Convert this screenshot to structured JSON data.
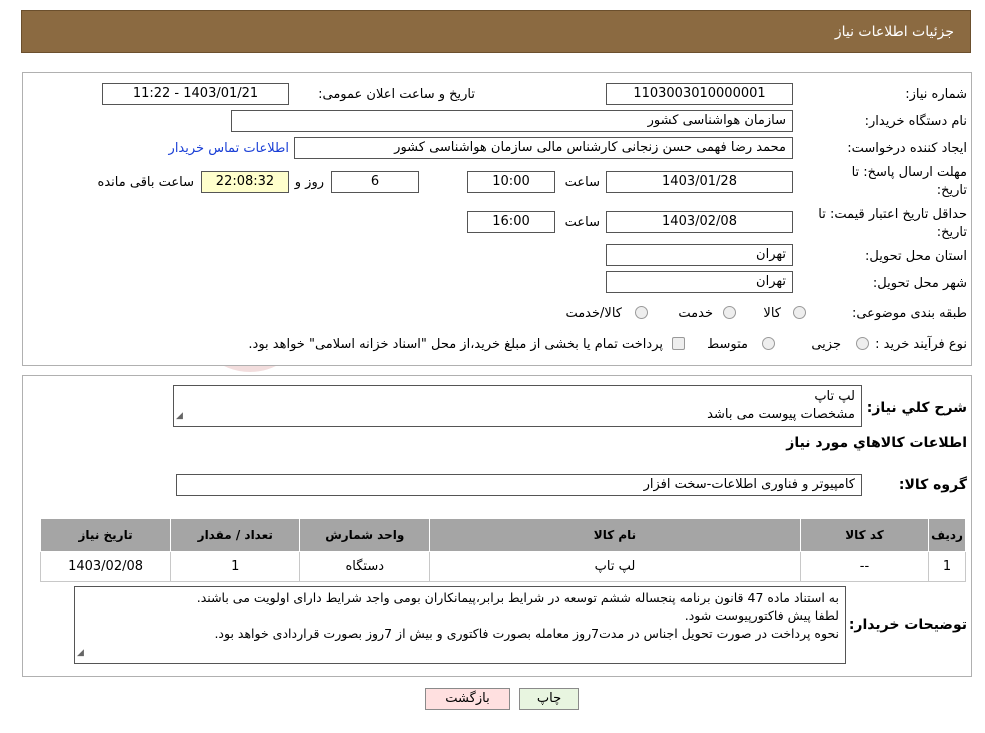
{
  "header": {
    "title": "جزئیات اطلاعات نیاز"
  },
  "form": {
    "need_number_label": "شماره نیاز:",
    "need_number": "1103003010000001",
    "announce_label": "تاریخ و ساعت اعلان عمومی:",
    "announce_value": "1403/01/21 - 11:22",
    "buyer_org_label": "نام دستگاه خریدار:",
    "buyer_org": "سازمان هواشناسی کشور",
    "requester_label": "ایجاد کننده درخواست:",
    "requester": "محمد رضا فهمی حسن زنجانی کارشناس مالی سازمان هواشناسی کشور",
    "contact_link": "اطلاعات تماس خریدار",
    "reply_deadline_label_1": "مهلت ارسال پاسخ: تا",
    "reply_deadline_label_2": "تاریخ:",
    "reply_date": "1403/01/28",
    "time_label": "ساعت",
    "reply_time": "10:00",
    "days_value": "6",
    "days_label": "روز و",
    "remaining_time": "22:08:32",
    "remaining_label": "ساعت باقی مانده",
    "price_valid_label_1": "حداقل تاریخ اعتبار قیمت: تا",
    "price_valid_label_2": "تاریخ:",
    "price_valid_date": "1403/02/08",
    "price_valid_time": "16:00",
    "province_label": "استان محل تحویل:",
    "province": "تهران",
    "city_label": "شهر محل تحویل:",
    "city": "تهران",
    "category_label": "طبقه بندی موضوعی:",
    "category_options": [
      "کالا",
      "خدمت",
      "کالا/خدمت"
    ],
    "process_label": "نوع فرآیند خرید :",
    "process_options": [
      "جزیی",
      "متوسط"
    ],
    "process_note": "پرداخت تمام یا بخشی از مبلغ خرید،از محل \"اسناد خزانه اسلامی\" خواهد بود."
  },
  "details": {
    "summary_label": "شرح کلي نياز:",
    "summary_line1": "لپ تاپ",
    "summary_line2": "مشخصات پیوست می باشد",
    "goods_info_title": "اطلاعات کالاهاي مورد نياز",
    "goods_group_label": "گروه کالا:",
    "goods_group": "کامپیوتر و فناوری اطلاعات-سخت افزار",
    "table": {
      "headers": [
        "رديف",
        "کد کالا",
        "نام کالا",
        "واحد شمارش",
        "تعداد / مقدار",
        "تاریخ نیاز"
      ],
      "rows": [
        [
          "1",
          "--",
          "لپ تاپ",
          "دستگاه",
          "1",
          "1403/02/08"
        ]
      ]
    },
    "buyer_notes_label": "توضيحات خريدار:",
    "buyer_notes_line1": "به استناد ماده 47 قانون برنامه پنجساله ششم توسعه در شرایط برابر،پیمانکاران بومی واجد شرایط دارای اولویت می باشند.",
    "buyer_notes_line2": "لطفا پیش فاکتورپیوست شود.",
    "buyer_notes_line3": "نحوه پرداخت در صورت تحویل اجناس در مدت7روز معامله بصورت فاکتوری و بیش از 7روز بصورت قراردادی خواهد بود."
  },
  "buttons": {
    "print": "چاپ",
    "back": "بازگشت"
  },
  "colors": {
    "header_bg": "#8b6a41",
    "table_header_bg": "#a5a5a5",
    "back_btn_bg": "#ffe0e0",
    "print_btn_bg": "#e8f5e0",
    "link": "#1a3fd6"
  }
}
